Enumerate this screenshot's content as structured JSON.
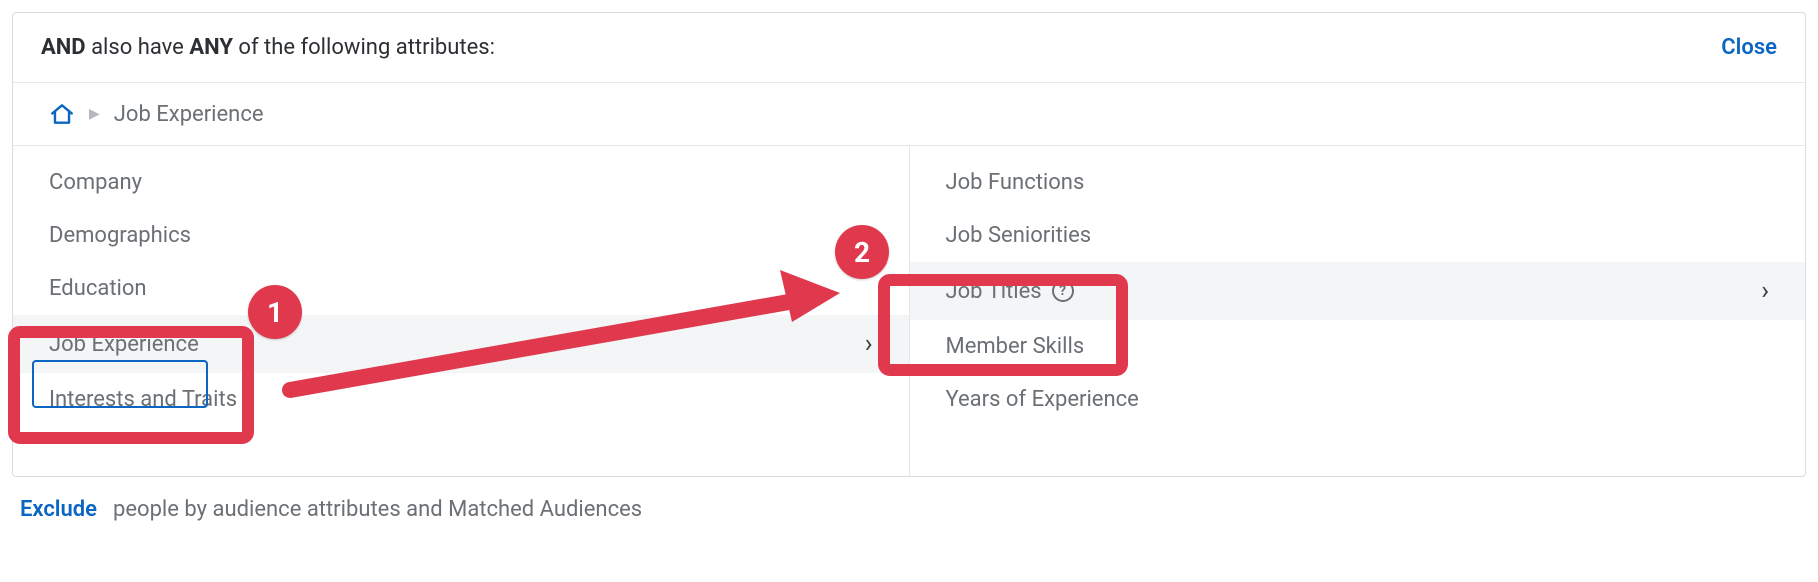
{
  "header": {
    "prefix_bold": "AND",
    "mid_text": " also have ",
    "any_bold": "ANY",
    "suffix_text": " of the following attributes:",
    "close_label": "Close"
  },
  "breadcrumb": {
    "current": "Job Experience"
  },
  "left_col": {
    "items": [
      {
        "label": "Company",
        "active": false
      },
      {
        "label": "Demographics",
        "active": false
      },
      {
        "label": "Education",
        "active": false
      },
      {
        "label": "Job Experience",
        "active": true
      },
      {
        "label": "Interests and Traits",
        "active": false
      }
    ]
  },
  "right_col": {
    "items": [
      {
        "label": "Job Functions",
        "active": false,
        "help": false
      },
      {
        "label": "Job Seniorities",
        "active": false,
        "help": false
      },
      {
        "label": "Job Titles",
        "active": true,
        "help": true
      },
      {
        "label": "Member Skills",
        "active": false,
        "help": false
      },
      {
        "label": "Years of Experience",
        "active": false,
        "help": false
      }
    ]
  },
  "footer": {
    "exclude_label": "Exclude",
    "rest": "people by audience attributes and Matched Audiences"
  },
  "annotations": {
    "badge1": "1",
    "badge2": "2"
  }
}
